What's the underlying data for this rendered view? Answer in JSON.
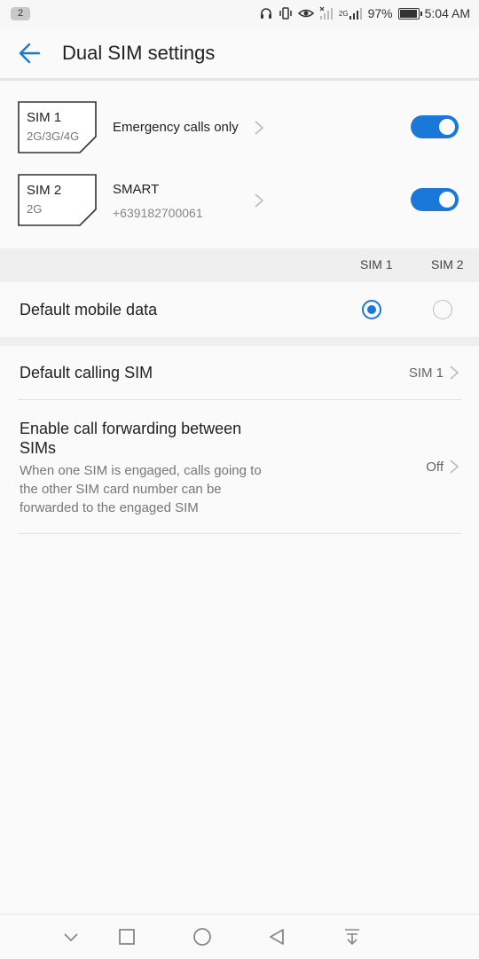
{
  "status_bar": {
    "notification_count": "2",
    "network_type": "2G",
    "battery_percent": "97%",
    "battery_level": 0.97,
    "time": "5:04 AM"
  },
  "header": {
    "back_icon": "arrow-left-icon",
    "title": "Dual SIM settings"
  },
  "sims": [
    {
      "name": "SIM 1",
      "networks": "2G/3G/4G",
      "label": "Emergency calls only",
      "sub": "",
      "enabled": true
    },
    {
      "name": "SIM 2",
      "networks": "2G",
      "label": "SMART",
      "sub": "+639182700061",
      "enabled": true
    }
  ],
  "defaults": {
    "columns": [
      "SIM 1",
      "SIM 2"
    ],
    "mobile_data": {
      "label": "Default mobile data",
      "selected": "SIM 1"
    }
  },
  "calling": {
    "label": "Default calling SIM",
    "value": "SIM 1"
  },
  "forwarding": {
    "title": "Enable call forwarding between SIMs",
    "description": "When one SIM is engaged, calls going to the other SIM card number can be forwarded to the engaged SIM",
    "value": "Off"
  },
  "colors": {
    "accent": "#1a78d8",
    "background": "#fafafa",
    "band": "#efefef"
  },
  "nav_bar": {
    "icons": [
      "chevron-down-icon",
      "square-icon",
      "circle-icon",
      "triangle-back-icon",
      "pull-down-icon"
    ]
  }
}
